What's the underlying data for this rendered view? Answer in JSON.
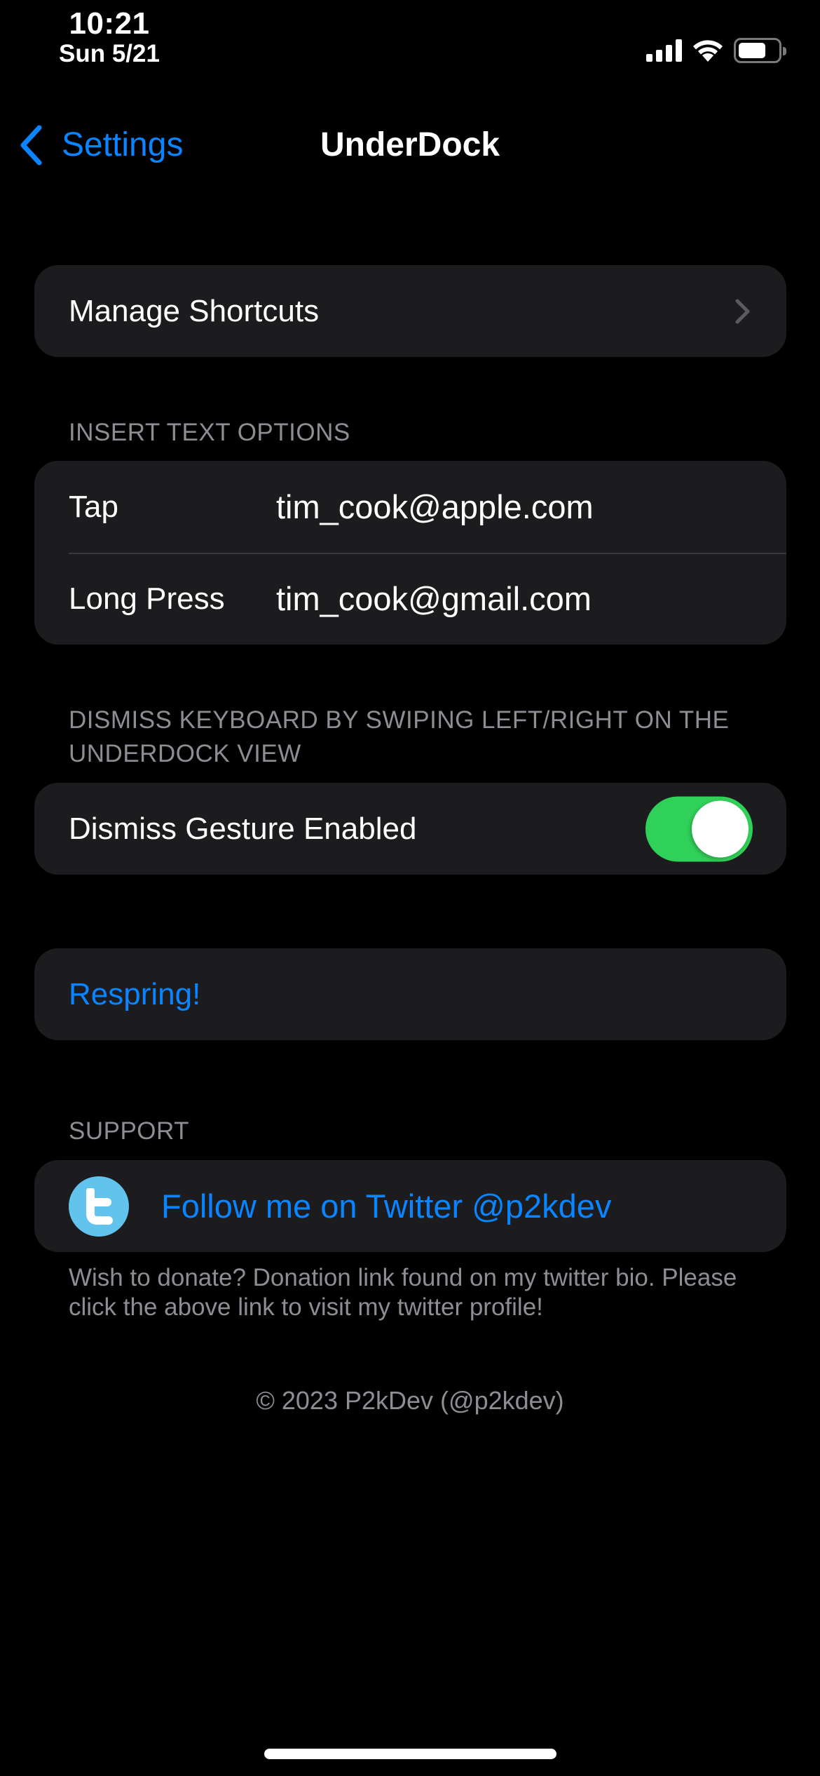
{
  "status_bar": {
    "time": "10:21",
    "date": "Sun 5/21",
    "icons": [
      "cellular-signal-icon",
      "wifi-icon",
      "battery-icon"
    ],
    "battery_level": 0.7
  },
  "nav": {
    "back_label": "Settings",
    "back_icon": "chevron-left-icon",
    "title": "UnderDock"
  },
  "sections": {
    "shortcuts": {
      "item_label": "Manage Shortcuts",
      "item_icon": "chevron-right-icon"
    },
    "insert_text": {
      "header": "INSERT TEXT OPTIONS",
      "rows": [
        {
          "label": "Tap",
          "value": "tim_cook@apple.com"
        },
        {
          "label": "Long Press",
          "value": "tim_cook@gmail.com"
        }
      ]
    },
    "dismiss": {
      "header": "DISMISS KEYBOARD BY SWIPING LEFT/RIGHT ON THE UNDERDOCK VIEW",
      "toggle_label": "Dismiss Gesture Enabled",
      "toggle_on": true
    },
    "respring": {
      "label": "Respring!"
    },
    "support": {
      "header": "SUPPORT",
      "link_label": "Follow me on Twitter @p2kdev",
      "link_icon": "twitter-icon",
      "footer": "Wish to donate? Donation link found on my twitter bio. Please click the above link to visit my twitter profile!"
    }
  },
  "copyright": "© 2023 P2kDev (@p2kdev)",
  "colors": {
    "accent": "#0A84FF",
    "toggle_on": "#30D158",
    "card_bg": "#1C1C1E",
    "secondary_text": "#8D8D93",
    "twitter_blue": "#62C3EC"
  }
}
